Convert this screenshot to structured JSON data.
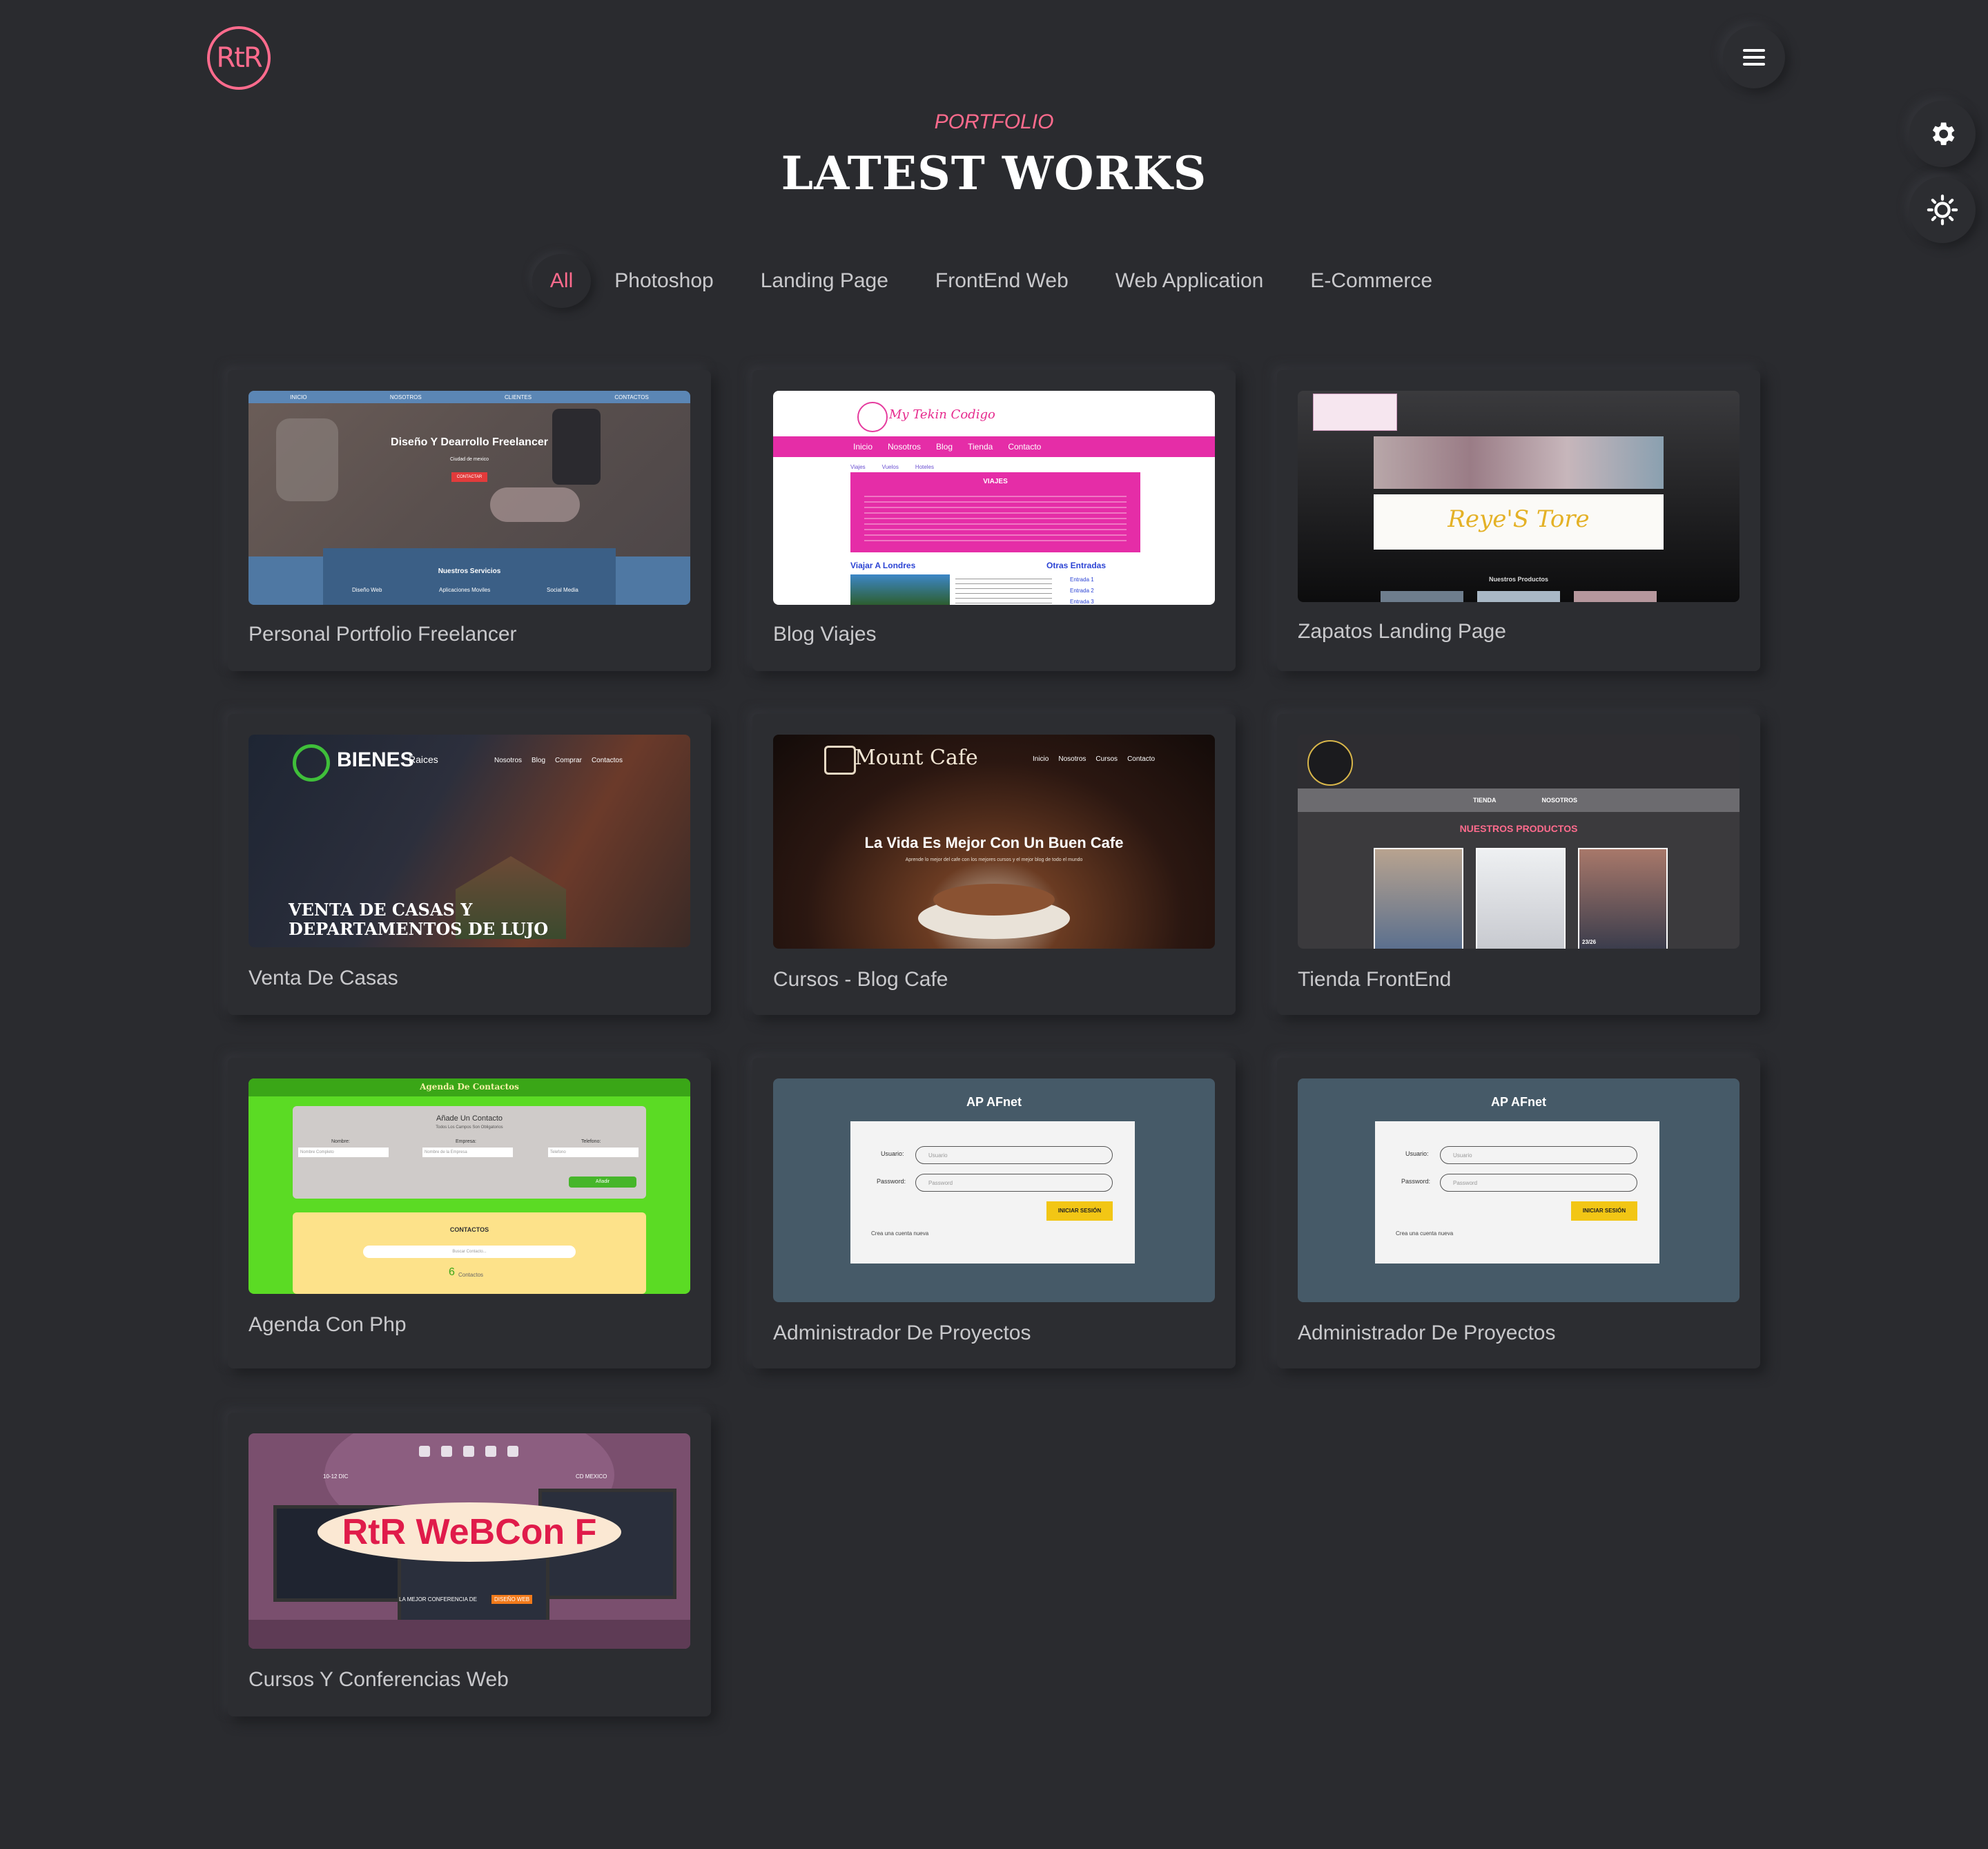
{
  "brand": {
    "logo_text": "RtR"
  },
  "header": {
    "eyebrow": "PORTFOLIO",
    "title": "LATEST WORKS"
  },
  "icons": {
    "menu": "hamburger-icon",
    "settings": "gear-icon",
    "theme": "sun-icon"
  },
  "colors": {
    "accent": "#ff6b8d",
    "background": "#2a2b2f",
    "card": "#2c2d31"
  },
  "filters": [
    "All",
    "Photoshop",
    "Landing Page",
    "FrontEnd Web",
    "Web Application",
    "E-Commerce"
  ],
  "active_filter": "All",
  "works": [
    {
      "title": "Personal Portfolio Freelancer"
    },
    {
      "title": "Blog Viajes"
    },
    {
      "title": "Zapatos Landing Page"
    },
    {
      "title": "Venta De Casas"
    },
    {
      "title": "Cursos - Blog Cafe"
    },
    {
      "title": "Tienda FrontEnd"
    },
    {
      "title": "Agenda Con Php"
    },
    {
      "title": "Administrador De Proyectos"
    },
    {
      "title": "Administrador De Proyectos"
    },
    {
      "title": "Cursos Y Conferencias Web"
    }
  ],
  "thumbs": {
    "t0": {
      "nav": [
        "INICIO",
        "NOSOTROS",
        "CLIENTES",
        "CONTACTOS"
      ],
      "headline": "Diseño Y Dearrollo Freelancer",
      "location": "Ciudad de mexico",
      "button": "CONTACTAR",
      "services": "Nuestros Servicios",
      "service_items": [
        "Diseño Web",
        "Aplicaciones Moviles",
        "Social Media"
      ]
    },
    "t1": {
      "brand": "My Tekin Codigo",
      "nav": [
        "Inicio",
        "Nosotros",
        "Blog",
        "Tienda",
        "Contacto"
      ],
      "tabs": [
        "Viajes",
        "Vuelos",
        "Hoteles"
      ],
      "box_title": "VIAJES",
      "post_title": "Viajar A Londres",
      "side_title": "Otras Entradas",
      "side_links": [
        "Entrada 1",
        "Entrada 2",
        "Entrada 3"
      ]
    },
    "t2": {
      "banner": "Reye'S Tore",
      "section": "Nuestros Productos"
    },
    "t3": {
      "brand": "BIENES",
      "brand_sub": "Raices",
      "nav": [
        "Nosotros",
        "Blog",
        "Comprar",
        "Contactos"
      ],
      "headline": "VENTA DE CASAS Y DEPARTAMENTOS DE LUJO"
    },
    "t4": {
      "brand": "Mount Cafe",
      "nav": [
        "Inicio",
        "Nosotros",
        "Cursos",
        "Contacto"
      ],
      "headline": "La Vida Es Mejor Con Un Buen Cafe",
      "sub": "Aprende lo mejor del cafe con los mejores cursos y el mejor blog de todo el mundo"
    },
    "t5": {
      "nav": [
        "TIENDA",
        "NOSOTROS"
      ],
      "section": "NUESTROS PRODUCTOS",
      "tag": "23/26"
    },
    "t6": {
      "header": "Agenda De Contactos",
      "form_title": "Añade Un Contacto",
      "form_sub": "Todos Los Campos Son Obligatorios",
      "labels": [
        "Nombre:",
        "Empresa:",
        "Telefono:"
      ],
      "placeholders": [
        "Nombre Completo",
        "Nombre de la Empresa",
        "Telefono"
      ],
      "button": "Añadir",
      "contacts_title": "CONTACTOS",
      "search": "Buscar Contacto...",
      "count": "6",
      "count_label": "Contactos"
    },
    "t7": {
      "title": "AP AFnet",
      "user_label": "Usuario:",
      "user_ph": "Usuario",
      "pass_label": "Password:",
      "pass_ph": "Password",
      "button": "INICIAR SESIÓN",
      "link": "Crea una cuenta nueva"
    },
    "t9": {
      "date": "10-12 DIC",
      "place": "CD MEXICO",
      "banner": "RtR WeBCon F",
      "caption": "LA MEJOR CONFERENCIA DE",
      "caption_hl": "DISEÑO WEB"
    }
  }
}
